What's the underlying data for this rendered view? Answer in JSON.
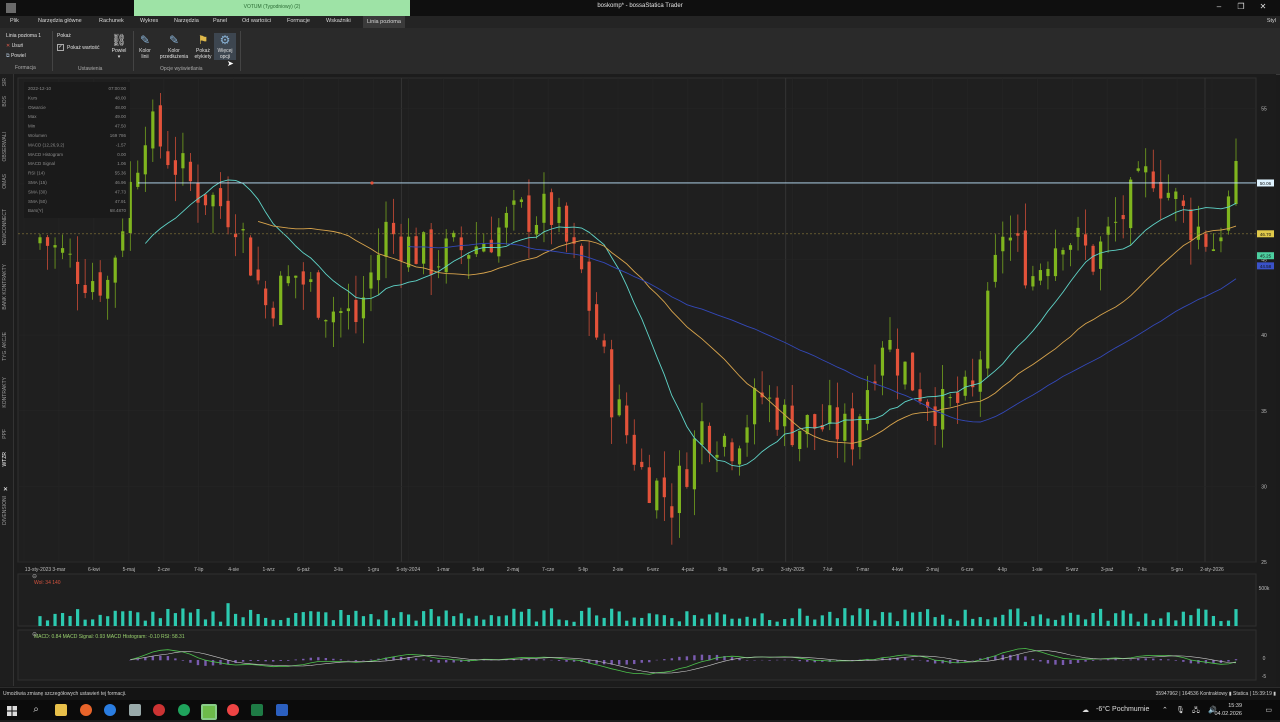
{
  "window": {
    "title": "boskomp* - bossaStatica Trader",
    "context_title": "VOTUM (Tygodniowy) (2)",
    "controls": [
      "–",
      "❐",
      "✕"
    ]
  },
  "menu": {
    "items": [
      "Plik",
      "Narzędzia główne",
      "Rachunek",
      "Wykres",
      "Narzędzia",
      "Panel",
      "Od wartości",
      "Formacje",
      "Wskaźniki",
      "Linia pozioma"
    ],
    "active": "Linia pozioma",
    "style_label": "Styl"
  },
  "ribbon": {
    "formation": {
      "name_label": "Linia pozioma 1",
      "delete_label": "Usuń",
      "repeat_label": "Powiel",
      "group_label": "Formacja"
    },
    "settings": {
      "show_label": "Pokaż",
      "show_value_label": "Pokaż wartość",
      "group_label": "Ustawienia"
    },
    "display": {
      "powiel": "Powiel",
      "line_color": "Kolor linii",
      "ext_color": "Kolor przedłużenia",
      "show_labels": "Pokaż etykiety",
      "more_options": "Więcej opcji",
      "group_label": "Opcje wyświetlania"
    }
  },
  "sidebar": {
    "tabs": [
      "SIR",
      "BOS",
      "OBSERWALI",
      "OMAS",
      "NEWCONNECT",
      "BANK KONTRAKTY",
      "TYG. AKCJE",
      "KONTRAKTY",
      "PPF",
      "WTZR",
      "DIVENSIONI"
    ],
    "active": "WTZR"
  },
  "data_window": {
    "rows": [
      {
        "label": "2022-12-10",
        "value": "07:00:00"
      },
      {
        "label": "Kurs",
        "value": "48.00"
      },
      {
        "label": "Otwarcie",
        "value": "48.00"
      },
      {
        "label": "Max",
        "value": "49.00"
      },
      {
        "label": "Min",
        "value": "47.50"
      },
      {
        "label": "Wolumen",
        "value": "169 786"
      },
      {
        "label": "MACD (12,26,9.2)",
        "value": "-1.57"
      },
      {
        "label": "MACD Histogram",
        "value": "0.00"
      },
      {
        "label": "MACD Signal",
        "value": "1.06"
      },
      {
        "label": "RSI (14)",
        "value": "55.36"
      },
      {
        "label": "SMA (15)",
        "value": "46.96"
      },
      {
        "label": "SMA (30)",
        "value": "47.73"
      },
      {
        "label": "SMA (50)",
        "value": "47.91"
      },
      {
        "label": "Bars(Y)",
        "value": "68.4870"
      }
    ]
  },
  "price_axis": {
    "ticks": [
      "55",
      "50",
      "45",
      "40",
      "35",
      "30",
      "25"
    ],
    "tags": [
      {
        "text": "50.06",
        "color": "#dff3ff"
      },
      {
        "text": "46.70",
        "color": "#e0c94a"
      },
      {
        "text": "45.25",
        "color": "#4ccfa0"
      },
      {
        "text": "44.58",
        "color": "#3a52c8"
      }
    ]
  },
  "time_axis": {
    "labels": [
      "13-sty-2023",
      "3-mar",
      "6-kwi",
      "5-maj",
      "2-cze",
      "7-lip",
      "4-sie",
      "1-wrz",
      "6-paź",
      "3-lis",
      "1-gru",
      "5-sty-2024",
      "1-mar",
      "5-kwi",
      "2-maj",
      "7-cze",
      "5-lip",
      "2-sie",
      "6-wrz",
      "4-paź",
      "8-lis",
      "6-gru",
      "3-sty-2025",
      "7-lut",
      "7-mar",
      "4-kwi",
      "2-maj",
      "6-cze",
      "4-lip",
      "1-sie",
      "5-wrz",
      "3-paź",
      "7-lis",
      "5-gru",
      "2-sty-2026"
    ]
  },
  "panels": {
    "volume_label": "Wol: 34 140",
    "volume_scale": "500k",
    "macd_label": "MACD: 0.84 MACD Signal: 0.93 MACD Histogram: -0.10 RSI: 58.31",
    "macd_scale": [
      "0",
      "-5"
    ]
  },
  "status": {
    "message": "Umożliwia zmianę szczegółowych ustawień tej formacji.",
    "right": "35947962 | 164536 Kontraktowy  ▮  Statica | 15:39:19 ▮"
  },
  "taskbar": {
    "weather": "-6°C  Pochmurnie",
    "time": "15:39",
    "date": "04.02.2026"
  },
  "colors": {
    "up": "#7fb51e",
    "down": "#e2523a",
    "sma15": "#5fd4c8",
    "sma30": "#d8a44c",
    "sma50": "#3348b8",
    "hline": "#bfe6ff",
    "volume": "#2ccab0"
  }
}
